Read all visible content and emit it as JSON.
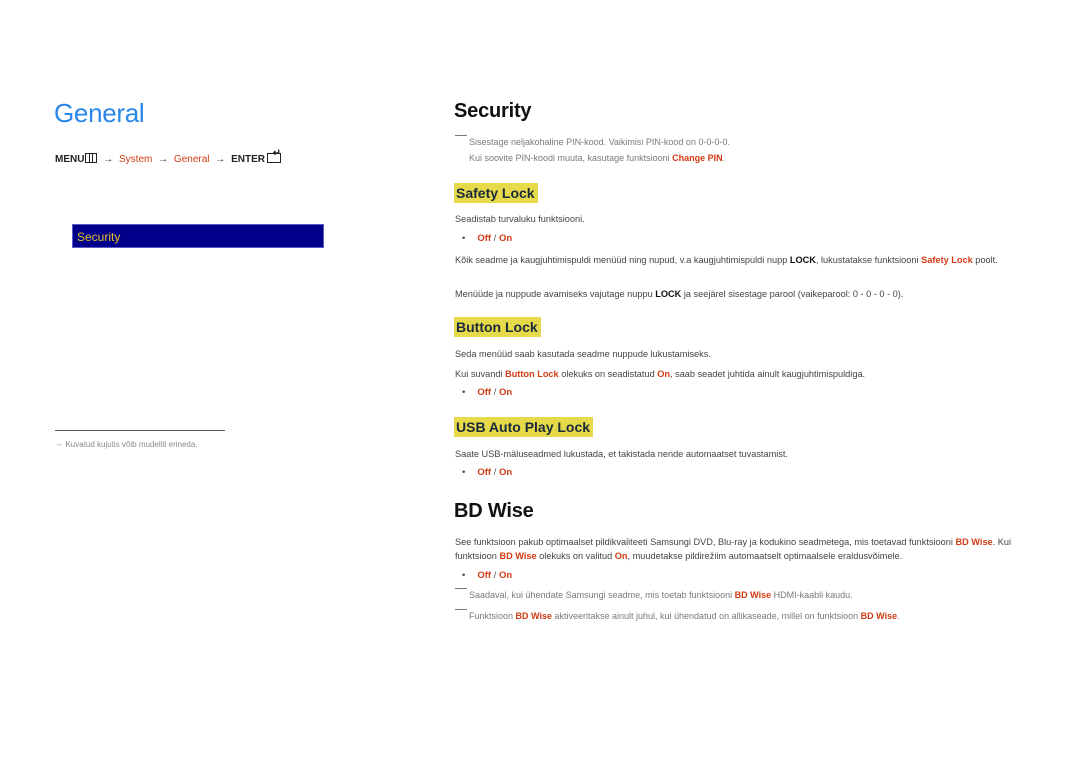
{
  "left": {
    "title": "General",
    "menu_path": {
      "menu": "MENU",
      "arrow": "→",
      "system": "System",
      "general": "General",
      "enter": "ENTER"
    },
    "menu_box_item": "Security",
    "footnote": "Kuvatud kujutis võib mudeliti erineda.",
    "footnote_dash": "–"
  },
  "security": {
    "title": "Security",
    "note_line1": "Sisestage neljakohaline PIN-kood. Vaikimisi PIN-kood on 0-0-0-0.",
    "note_line2_pre": "Kui soovite PIN-koodi muuta, kasutage funktsiooni ",
    "note_line2_link": "Change PIN",
    "note_line2_post": "."
  },
  "safety_lock": {
    "title": "Safety Lock",
    "desc": "Seadistab turvaluku funktsiooni.",
    "options": {
      "off": "Off",
      "sep": " / ",
      "on": "On"
    },
    "p1_pre": "Kõik seadme ja kaugjuhtimispuldi menüüd ning nupud, v.a kaugjuhtimispuldi nupp ",
    "p1_lock": "LOCK",
    "p1_mid": ", lukustatakse funktsiooni ",
    "p1_link": "Safety Lock",
    "p1_post": " poolt.",
    "p2_pre": "Menüüde ja nuppude avamiseks vajutage nuppu ",
    "p2_lock": "LOCK",
    "p2_post": " ja seejärel sisestage parool (vaikeparool: 0 - 0 - 0 - 0)."
  },
  "button_lock": {
    "title": "Button Lock",
    "desc": "Seda menüüd saab kasutada seadme nuppude lukustamiseks.",
    "p1_pre": "Kui suvandi ",
    "p1_link": "Button Lock",
    "p1_mid": " olekuks on seadistatud ",
    "p1_on": "On",
    "p1_post": ", saab seadet juhtida ainult kaugjuhtimispuldiga.",
    "options": {
      "off": "Off",
      "sep": " / ",
      "on": "On"
    }
  },
  "usb_auto_play_lock": {
    "title": "USB Auto Play Lock",
    "desc": "Saate USB-mäluseadmed lukustada, et takistada nende automaatset tuvastamist.",
    "options": {
      "off": "Off",
      "sep": " / ",
      "on": "On"
    }
  },
  "bd_wise": {
    "title": "BD Wise",
    "p1_pre": "See funktsioon pakub optimaalset pildikvaliteeti Samsungi DVD, Blu-ray ja kodukino seadmetega, mis toetavad funktsiooni ",
    "p1_link": "BD Wise",
    "p1_mid": ". Kui funktsioon ",
    "p1_link2": "BD Wise",
    "p1_mid2": " olekuks on valitud ",
    "p1_on": "On",
    "p1_post": ", muudetakse pildirežiim automaatselt optimaalsele eraldusvõimele.",
    "options": {
      "off": "Off",
      "sep": " / ",
      "on": "On"
    },
    "note1_pre": "Saadaval, kui ühendate Samsungi seadme, mis toetab funktsiooni ",
    "note1_link": "BD Wise",
    "note1_post": " HDMI-kaabli kaudu.",
    "note2_pre": "Funktsioon ",
    "note2_link": "BD Wise",
    "note2_mid": " aktiveeritakse ainult juhul, kui ühendatud on allikaseade, millel on funktsioon ",
    "note2_link2": "BD Wise",
    "note2_post": "."
  },
  "colors": {
    "title_blue": "#2a86e8",
    "accent_red": "#d13c14",
    "highlight_yellow": "#e6d94a",
    "menu_box_navy": "#00008b",
    "menu_box_text": "#e8c020"
  }
}
